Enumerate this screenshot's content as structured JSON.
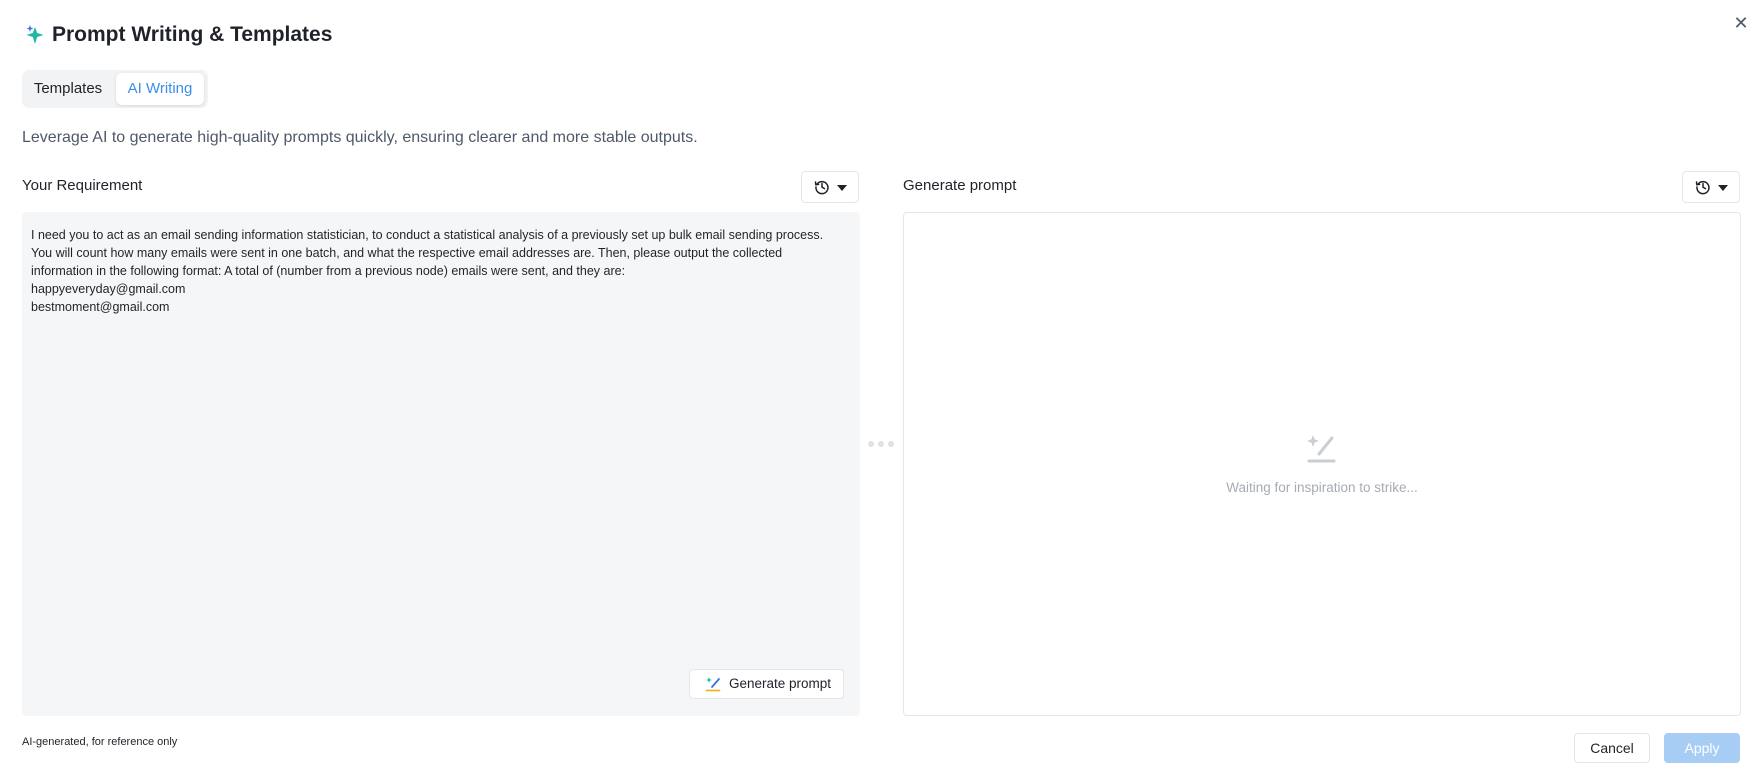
{
  "dialog": {
    "title": "Prompt Writing & Templates",
    "close_label": "✕"
  },
  "tabs": [
    {
      "label": "Templates",
      "selected": false
    },
    {
      "label": "AI Writing",
      "selected": true
    }
  ],
  "description": "Leverage AI to generate high-quality prompts quickly, ensuring clearer and more stable outputs.",
  "requirement_panel": {
    "label": "Your Requirement",
    "history_icon": "history-clock-icon",
    "text": "I need you to act as an email sending information statistician, to conduct a statistical analysis of a previously set up bulk email sending process.\nYou will count how many emails were sent in one batch, and what the respective email addresses are. Then, please output the collected\ninformation in the following format: A total of (number from a previous node) emails were sent, and they are:\nhappyeveryday@gmail.com\nbestmoment@gmail.com",
    "generate_button_label": "Generate prompt",
    "generate_icon": "magic-wand-icon"
  },
  "output_panel": {
    "label": "Generate prompt",
    "history_icon": "history-clock-icon",
    "empty_text": "Waiting for inspiration to strike...",
    "empty_icon": "magic-wand-icon"
  },
  "footer": {
    "note": "AI-generated, for reference only",
    "cancel_label": "Cancel",
    "apply_label": "Apply"
  },
  "colors": {
    "accent": "#3b8fe8",
    "apply_disabled": "#a7cdf5",
    "input_bg": "#f5f6f8",
    "muted_text": "#a6abb3"
  }
}
